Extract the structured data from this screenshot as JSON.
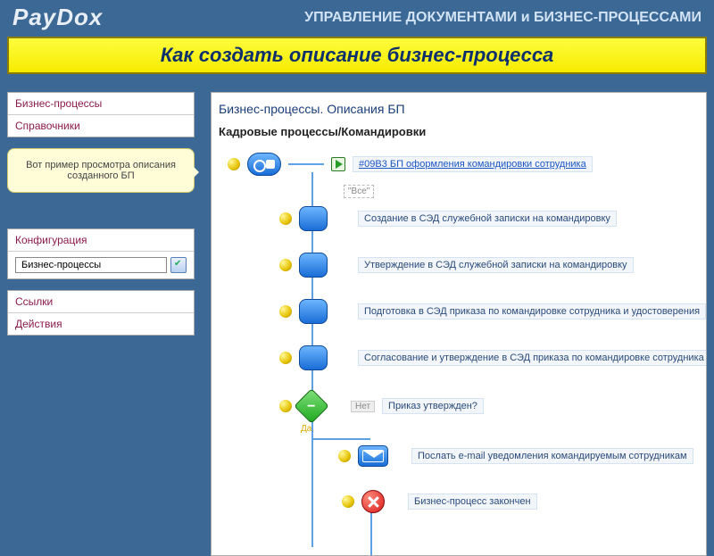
{
  "header": {
    "logo": "PayDox",
    "subtitle": "УПРАВЛЕНИЕ ДОКУМЕНТАМИ и БИЗНЕС-ПРОЦЕССАМИ"
  },
  "title": "Как создать описание бизнес-процесса",
  "sidebar": {
    "menu1": [
      "Бизнес-процессы",
      "Справочники"
    ],
    "callout": "Вот  пример просмотра описания созданного БП",
    "config_head": "Конфигурация",
    "config_value": "Бизнес-процессы",
    "menu2": [
      "Ссылки",
      "Действия"
    ]
  },
  "main": {
    "crumb1": "Бизнес-процессы. Описания БП",
    "crumb2": "Кадровые процессы/Командировки",
    "start_label": "#09B3 БП оформления командировки сотрудника",
    "all_label": "\"Все\"",
    "steps": [
      "Создание в СЭД служебной записки на командировку",
      "Утверждение в СЭД служебной записки на командировку",
      "Подготовка в СЭД приказа по командировке сотрудника и удостоверения",
      "Согласование и утверждение в СЭД приказа по командировке сотрудника"
    ],
    "decision_label": "Приказ утвержден?",
    "decision_no": "Нет",
    "decision_yes": "Да",
    "mail_label": "Послать e-mail уведомления командируемым сотрудникам",
    "end_label": "Бизнес-процесс закончен"
  }
}
